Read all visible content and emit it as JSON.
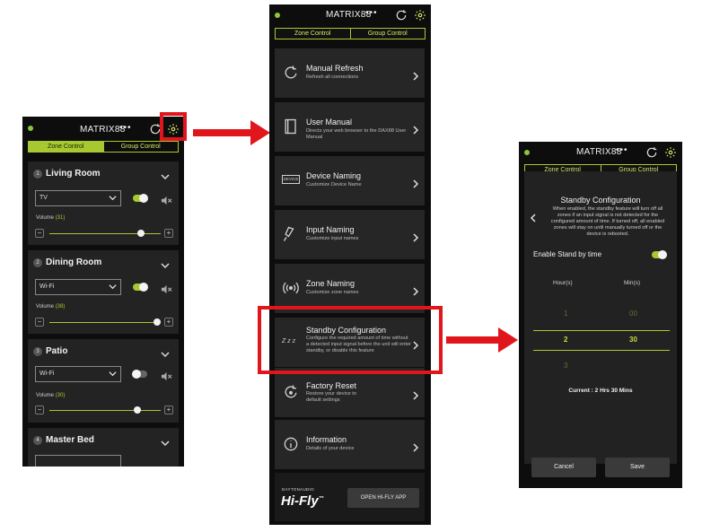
{
  "app": {
    "title": "MATRIX88",
    "tabs": [
      "Zone Control",
      "Group Control"
    ],
    "accent": "#a8c832",
    "highlight": "#e1161c"
  },
  "zones": [
    {
      "num": "1",
      "name": "Living Room",
      "source": "TV",
      "on": true,
      "volume_label": "Volume",
      "volume": "(31)",
      "volume_pct": 0.82
    },
    {
      "num": "2",
      "name": "Dining Room",
      "source": "Wi-Fi",
      "on": true,
      "volume_label": "Volume",
      "volume": "(38)",
      "volume_pct": 0.97
    },
    {
      "num": "3",
      "name": "Patio",
      "source": "Wi-Fi",
      "on": false,
      "volume_label": "Volume",
      "volume": "(30)",
      "volume_pct": 0.79
    },
    {
      "num": "4",
      "name": "Master Bed"
    }
  ],
  "menu": [
    {
      "icon": "refresh-icon",
      "title": "Manual Refresh",
      "sub": "Refresh all connections"
    },
    {
      "icon": "book-icon",
      "title": "User Manual",
      "sub": "Directs your web browser to the DAX88 User Manual"
    },
    {
      "icon": "device-label-icon",
      "title": "Device Naming",
      "sub": "Customize Device Name",
      "badge": "DEVICE"
    },
    {
      "icon": "plug-icon",
      "title": "Input Naming",
      "sub": "Customize input names"
    },
    {
      "icon": "broadcast-icon",
      "title": "Zone Naming",
      "sub": "Customize zone names"
    },
    {
      "icon": "sleep-icon",
      "title": "Standby Configuration",
      "sub": "Configure the required amount of time without a detected input signal before the unit will enter standby, or disable this feature",
      "glyph": "Z z z"
    },
    {
      "icon": "reset-icon",
      "title": "Factory Reset",
      "sub": "Restore your device to default settings"
    },
    {
      "icon": "info-icon",
      "title": "Information",
      "sub": "Details of your device"
    }
  ],
  "brand": {
    "small": "DAYTONAUDIO",
    "big": "Hi-Fly",
    "tm": "™",
    "button": "OPEN HI-FLY APP"
  },
  "standby": {
    "title": "Standby Configuration",
    "desc": "When enabled, the standby feature will turn off all zones if an input signal is not detected for the configured amount of time. If turned off, all enabled zones will stay on until manually turned off or the device is rebooted.",
    "enable_label": "Enable Stand by time",
    "hours_label": "Hour(s)",
    "mins_label": "Min(s)",
    "rows": [
      [
        "1",
        "00"
      ],
      [
        "2",
        "30"
      ],
      [
        "3",
        ""
      ]
    ],
    "current": "Current : 2 Hrs 30 Mins",
    "cancel": "Cancel",
    "save": "Save"
  }
}
